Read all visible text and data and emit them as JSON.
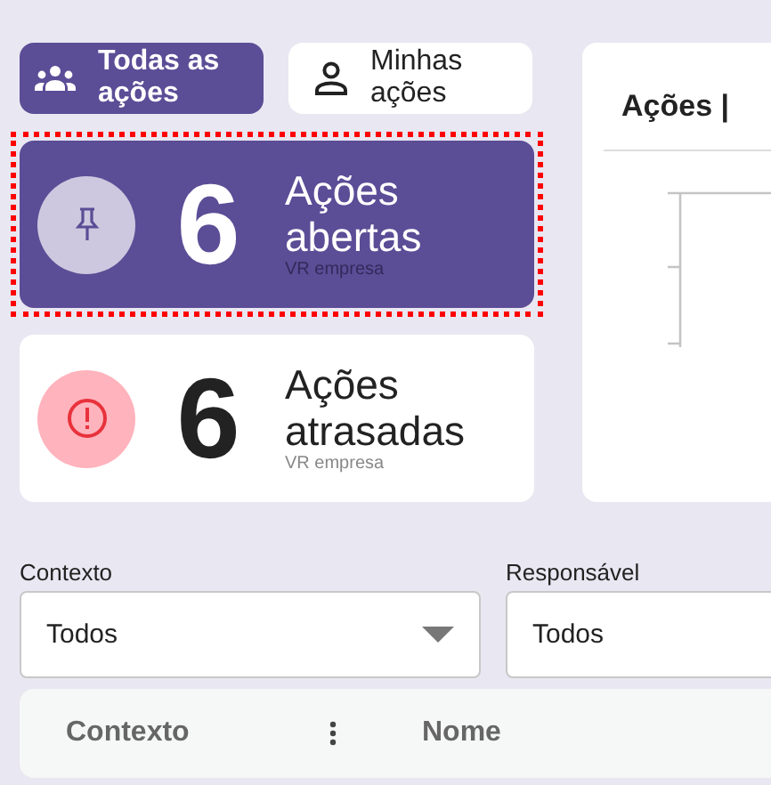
{
  "view_toggle": [
    {
      "label": "Todas as ações",
      "kind": "all",
      "selected": true
    },
    {
      "label": "Minhas ações",
      "kind": "mine",
      "selected": false
    }
  ],
  "summary_cards": [
    {
      "kind": "open",
      "count": "6",
      "title": "Ações abertas",
      "subtitle": "VR empresa",
      "selected": true
    },
    {
      "kind": "overdue",
      "count": "6",
      "title": "Ações atrasadas",
      "subtitle": "VR empresa",
      "selected": false
    }
  ],
  "chart_panel": {
    "title": "Ações |"
  },
  "filters": [
    {
      "label": "Contexto",
      "value": "Todos"
    },
    {
      "label": "Responsável",
      "value": "Todos"
    }
  ],
  "table": {
    "columns": [
      {
        "label": "Contexto",
        "menu": true
      },
      {
        "label": "Nome",
        "menu": false
      }
    ]
  }
}
